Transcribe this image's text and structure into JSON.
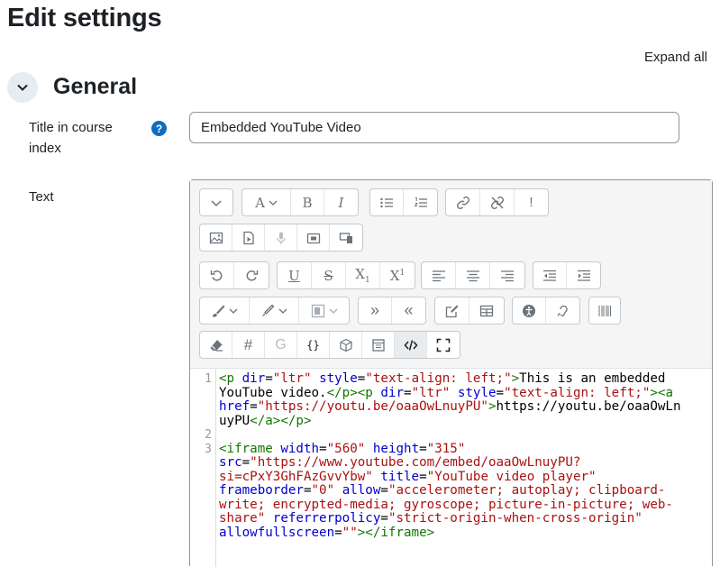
{
  "page": {
    "title": "Edit settings",
    "expand_all": "Expand all"
  },
  "section": {
    "title": "General"
  },
  "fields": {
    "title_label": "Title in course index",
    "title_value": "Embedded YouTube Video",
    "help_glyph": "?",
    "text_label": "Text"
  },
  "toolbar": {
    "icons": [
      "chevron-down-icon",
      "font-family-icon",
      "bold-icon",
      "italic-icon",
      "bullet-list-icon",
      "numbered-list-icon",
      "link-icon",
      "unlink-icon",
      "exclamation-icon",
      "image-icon",
      "media-icon",
      "microphone-icon",
      "video-camera-icon",
      "manage-files-icon",
      "undo-icon",
      "redo-icon",
      "underline-icon",
      "strikethrough-icon",
      "subscript-icon",
      "superscript-icon",
      "align-left-icon",
      "align-center-icon",
      "align-right-icon",
      "outdent-icon",
      "indent-icon",
      "text-color-icon",
      "background-color-icon",
      "style-icon",
      "indent-more-icon",
      "indent-less-icon",
      "edit-icon",
      "table-icon",
      "accessibility-checker-icon",
      "screenreader-helper-icon",
      "special-chars-icon",
      "clear-formatting-icon",
      "hash-icon",
      "g-icon",
      "braces-icon",
      "cube-icon",
      "calendar-icon",
      "html-code-icon",
      "fullscreen-icon"
    ],
    "glyphs": {
      "bold": "B",
      "italic": "I",
      "underline": "U",
      "strike": "S",
      "sub": "X",
      "sub_index": "1",
      "sup": "X",
      "sup_index": "1",
      "exclaim": "!",
      "hash": "#",
      "g": "G",
      "braces": "{}",
      "font_a": "A",
      "indent_more": "»",
      "indent_less": "«"
    }
  },
  "code": {
    "line_numbers": [
      "1",
      "2",
      "3"
    ],
    "lines": [
      [
        {
          "c": "t",
          "v": "<p "
        },
        {
          "c": "a",
          "v": "dir"
        },
        {
          "c": "",
          "v": "="
        },
        {
          "c": "s",
          "v": "\"ltr\""
        },
        {
          "c": "",
          "v": " "
        },
        {
          "c": "a",
          "v": "style"
        },
        {
          "c": "",
          "v": "="
        },
        {
          "c": "s",
          "v": "\"text-align: left;\""
        },
        {
          "c": "t",
          "v": ">"
        },
        {
          "c": "",
          "v": "This is an embedded"
        }
      ],
      [
        {
          "c": "",
          "v": "YouTube video."
        },
        {
          "c": "t",
          "v": "</p><p "
        },
        {
          "c": "a",
          "v": "dir"
        },
        {
          "c": "",
          "v": "="
        },
        {
          "c": "s",
          "v": "\"ltr\""
        },
        {
          "c": "",
          "v": " "
        },
        {
          "c": "a",
          "v": "style"
        },
        {
          "c": "",
          "v": "="
        },
        {
          "c": "s",
          "v": "\"text-align: left;\""
        },
        {
          "c": "t",
          "v": "><a"
        }
      ],
      [
        {
          "c": "a",
          "v": "href"
        },
        {
          "c": "",
          "v": "="
        },
        {
          "c": "s",
          "v": "\"https://youtu.be/oaaOwLnuyPU\""
        },
        {
          "c": "t",
          "v": ">"
        },
        {
          "c": "",
          "v": "https://youtu.be/oaaOwLn"
        }
      ],
      [
        {
          "c": "",
          "v": "uyPU"
        },
        {
          "c": "t",
          "v": "</a></p>"
        }
      ],
      [],
      [
        {
          "c": "t",
          "v": "<iframe "
        },
        {
          "c": "a",
          "v": "width"
        },
        {
          "c": "",
          "v": "="
        },
        {
          "c": "s",
          "v": "\"560\""
        },
        {
          "c": "",
          "v": " "
        },
        {
          "c": "a",
          "v": "height"
        },
        {
          "c": "",
          "v": "="
        },
        {
          "c": "s",
          "v": "\"315\""
        }
      ],
      [
        {
          "c": "a",
          "v": "src"
        },
        {
          "c": "",
          "v": "="
        },
        {
          "c": "s",
          "v": "\"https://www.youtube.com/embed/oaaOwLnuyPU?"
        }
      ],
      [
        {
          "c": "s",
          "v": "si=cPxY3GhFAzGvvYbw\""
        },
        {
          "c": "",
          "v": " "
        },
        {
          "c": "a",
          "v": "title"
        },
        {
          "c": "",
          "v": "="
        },
        {
          "c": "s",
          "v": "\"YouTube video player\""
        }
      ],
      [
        {
          "c": "a",
          "v": "frameborder"
        },
        {
          "c": "",
          "v": "="
        },
        {
          "c": "s",
          "v": "\"0\""
        },
        {
          "c": "",
          "v": " "
        },
        {
          "c": "a",
          "v": "allow"
        },
        {
          "c": "",
          "v": "="
        },
        {
          "c": "s",
          "v": "\"accelerometer; autoplay; clipboard-"
        }
      ],
      [
        {
          "c": "s",
          "v": "write; encrypted-media; gyroscope; picture-in-picture; web-"
        }
      ],
      [
        {
          "c": "s",
          "v": "share\""
        },
        {
          "c": "",
          "v": " "
        },
        {
          "c": "a",
          "v": "referrerpolicy"
        },
        {
          "c": "",
          "v": "="
        },
        {
          "c": "s",
          "v": "\"strict-origin-when-cross-origin\""
        }
      ],
      [
        {
          "c": "a",
          "v": "allowfullscreen"
        },
        {
          "c": "",
          "v": "="
        },
        {
          "c": "s",
          "v": "\"\""
        },
        {
          "c": "t",
          "v": "></iframe>"
        }
      ]
    ]
  }
}
